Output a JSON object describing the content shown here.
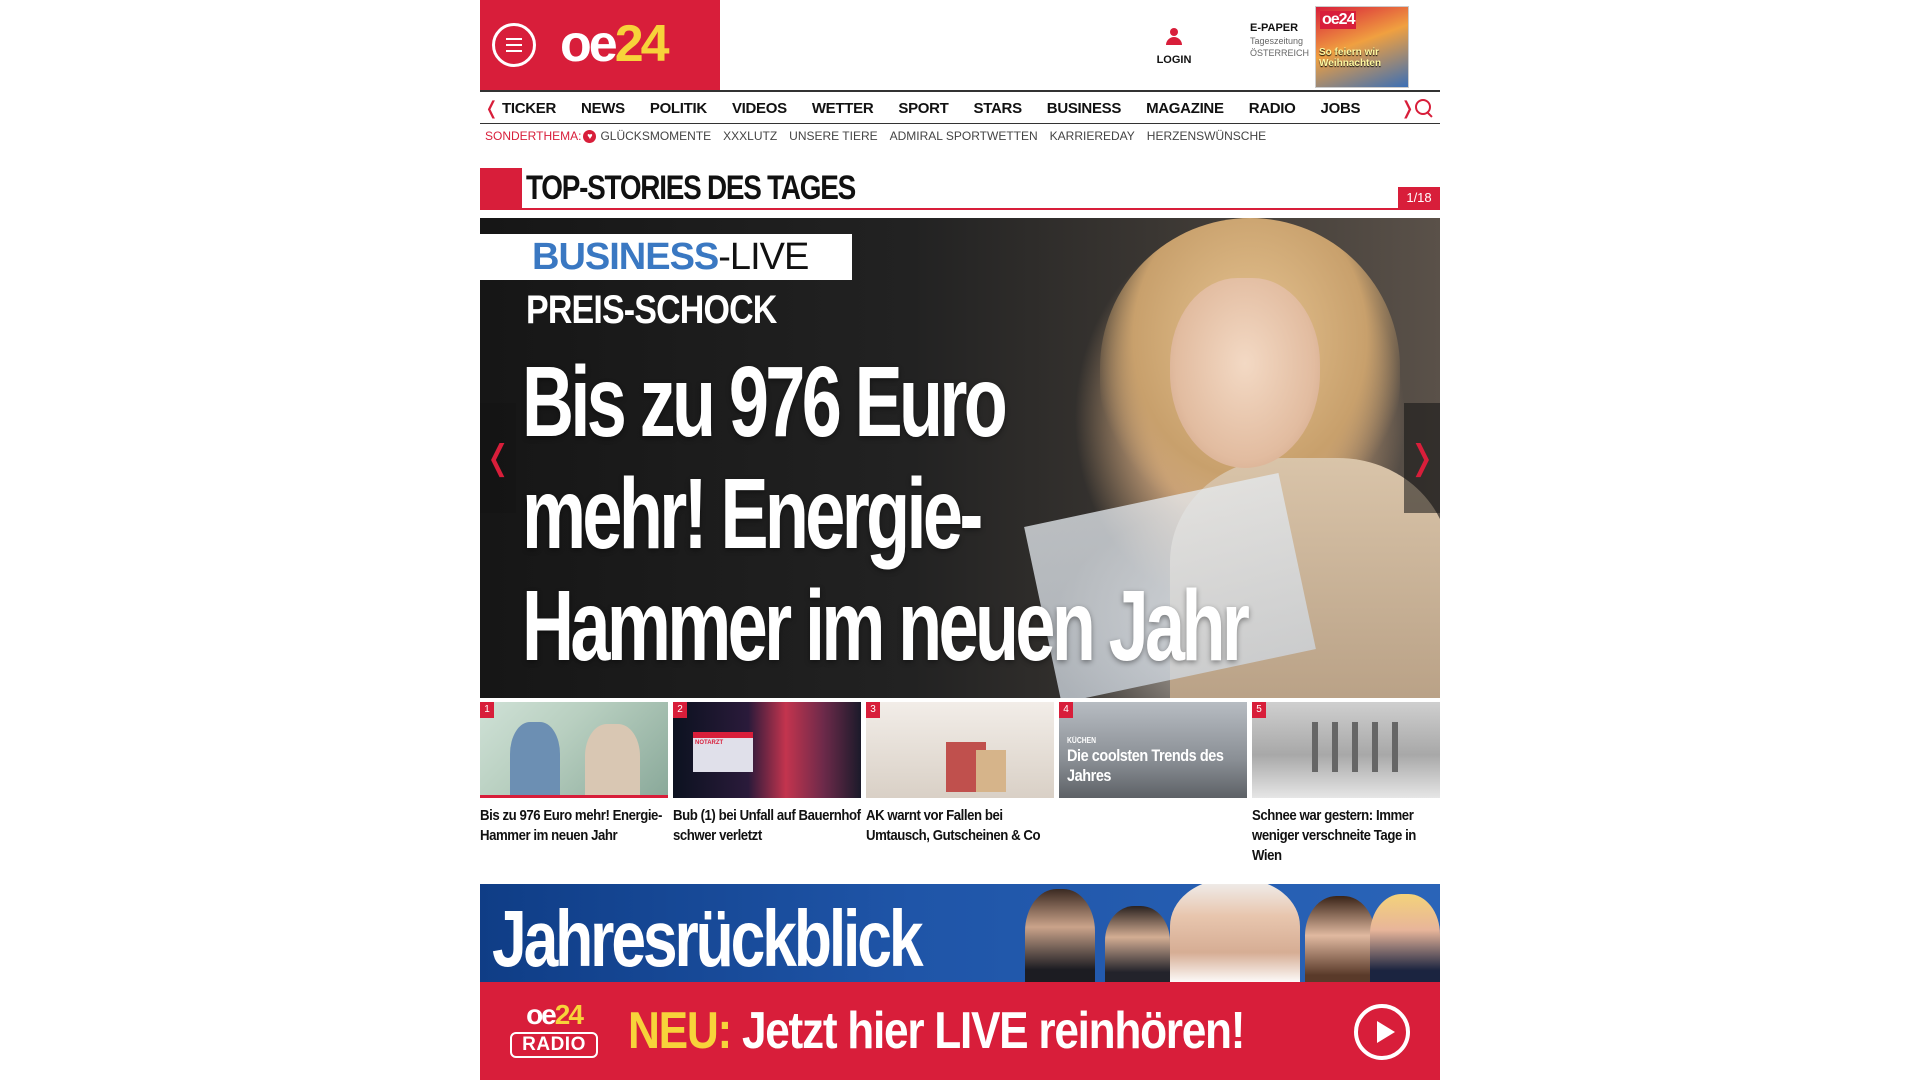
{
  "header": {
    "logo_oe": "oe",
    "logo_num": "24",
    "login_label": "LOGIN",
    "epaper": {
      "title": "E-PAPER",
      "sub1": "Tageszeitung",
      "sub2": "ÖSTERREICH",
      "cover_logo": "oe24",
      "cover_headline": "So feiern wir Weihnachten"
    }
  },
  "nav": {
    "items": [
      "TICKER",
      "NEWS",
      "POLITIK",
      "VIDEOS",
      "WETTER",
      "SPORT",
      "STARS",
      "BUSINESS",
      "MAGAZINE",
      "RADIO",
      "JOBS"
    ]
  },
  "sonder": {
    "label": "SONDERTHEMA:",
    "items": [
      "GLÜCKSMOMENTE",
      "XXXLUTZ",
      "UNSERE TIERE",
      "ADMIRAL SPORTWETTEN",
      "KARRIEREDAY",
      "HERZENSWÜNSCHE"
    ]
  },
  "top_stories": {
    "title": "TOP-STORIES DES TAGES",
    "counter": "1/18"
  },
  "hero": {
    "tag_business": "BUSINESS",
    "tag_live": "-LIVE",
    "kicker": "PREIS-SCHOCK",
    "title_line1": "Bis zu 976 Euro",
    "title_line2": "mehr! Energie-",
    "title_line3": "Hammer im neuen Jahr"
  },
  "thumbs": [
    {
      "num": "1",
      "caption": "Bis zu 976 Euro mehr! Energie-Hammer im neuen Jahr"
    },
    {
      "num": "2",
      "caption": "Bub (1) bei Unfall auf Bauernhof schwer verletzt",
      "img_text": "NOTARZT"
    },
    {
      "num": "3",
      "caption": "AK warnt vor Fallen bei Umtausch, Gutscheinen & Co"
    },
    {
      "num": "4",
      "caption": "",
      "overlay_small": "KÜCHEN",
      "overlay": "Die coolsten Trends des Jahres"
    },
    {
      "num": "5",
      "caption": "Schnee war gestern: Immer weniger verschneite Tage in Wien"
    }
  ],
  "banner": {
    "title": "Jahresrückblick",
    "radio_logo_oe": "oe",
    "radio_logo_num": "24",
    "radio_logo_label": "RADIO",
    "neu": "NEU:",
    "cta": " Jetzt hier LIVE reinhören!"
  },
  "colors": {
    "brand_red": "#d81e3a",
    "brand_yellow": "#f7d33a",
    "business_blue": "#3a78c2"
  }
}
